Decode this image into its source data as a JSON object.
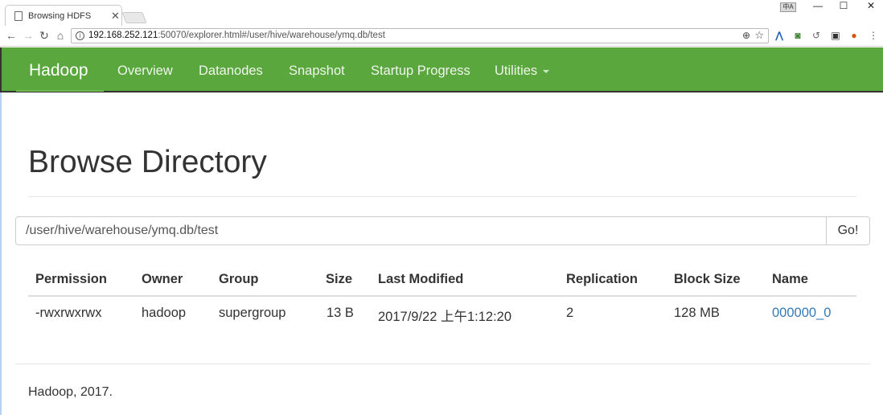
{
  "browser": {
    "tab_title": "Browsing HDFS",
    "tab_close": "✕",
    "ime_label": "中A",
    "url_host": "192.168.252.121",
    "url_rest": ":50070/explorer.html#/user/hive/warehouse/ymq.db/test"
  },
  "navbar": {
    "brand": "Hadoop",
    "items": [
      "Overview",
      "Datanodes",
      "Snapshot",
      "Startup Progress",
      "Utilities"
    ]
  },
  "page": {
    "title": "Browse Directory",
    "path_value": "/user/hive/warehouse/ymq.db/test",
    "go_label": "Go!"
  },
  "table": {
    "headers": [
      "Permission",
      "Owner",
      "Group",
      "Size",
      "Last Modified",
      "Replication",
      "Block Size",
      "Name"
    ],
    "rows": [
      [
        "-rwxrwxrwx",
        "hadoop",
        "supergroup",
        "13 B",
        "2017/9/22 上午1:12:20",
        "2",
        "128 MB",
        "000000_0"
      ]
    ]
  },
  "footer": {
    "text": "Hadoop, 2017."
  },
  "colors": {
    "navbar": "#5aa73e",
    "link": "#337ab7"
  }
}
